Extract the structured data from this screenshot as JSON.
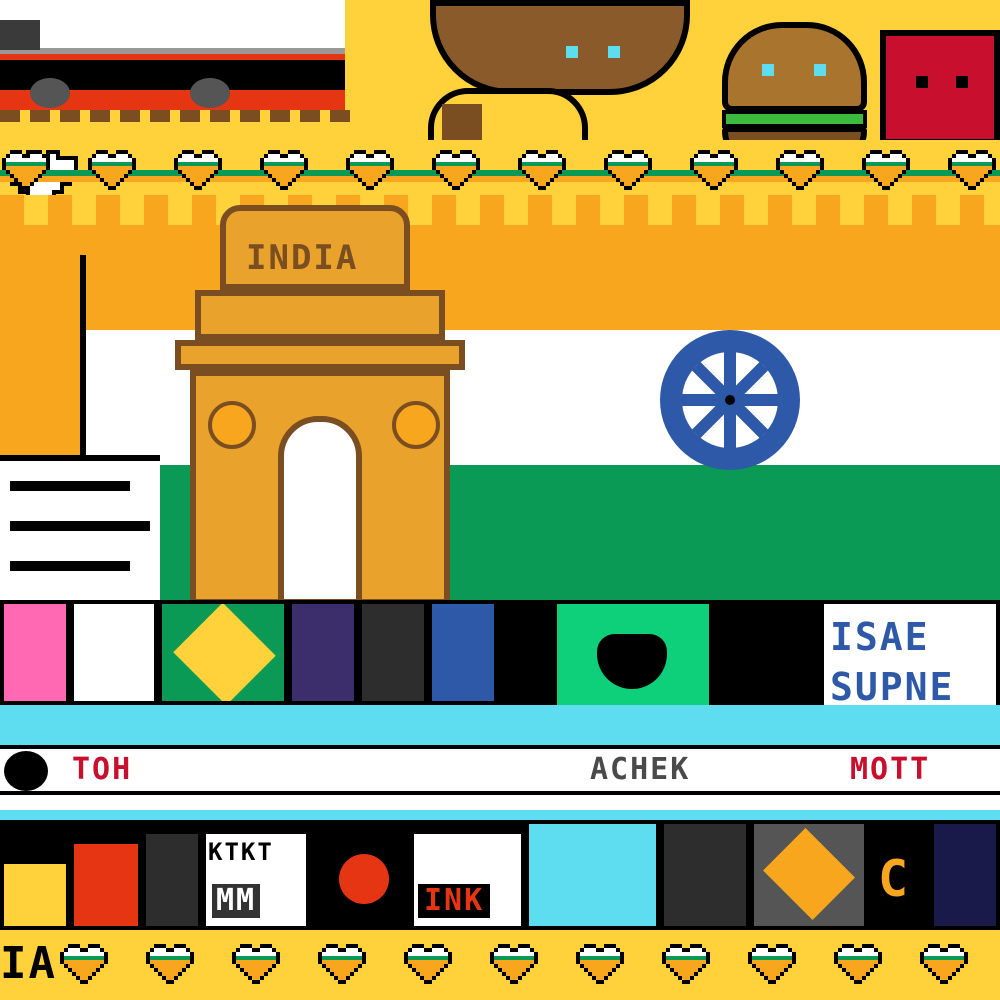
{
  "colors": {
    "saffron": "#F8A61E",
    "white": "#FFFFFF",
    "green": "#0A9A55",
    "chakra": "#2E59A8",
    "gate": "#E9A22B",
    "gate_dark": "#7A4E20",
    "cyan": "#5EDCF0",
    "black": "#000000",
    "red": "#E53512",
    "yellow": "#FFD23C"
  },
  "gate": {
    "inscription": "INDIA"
  },
  "tiles_top": [
    {
      "text": "ISAE"
    },
    {
      "text": "SUPNE"
    }
  ],
  "tiles_bottom": [
    {
      "text": "KTKT"
    },
    {
      "text": "MM"
    },
    {
      "text": "INK"
    },
    {
      "text": "C"
    }
  ],
  "banner_text": {
    "left": "TOH",
    "mid": "ACHEK",
    "right": "MOTT"
  },
  "bottom_left_text": "IA",
  "icons": {
    "food": [
      "dumpling-icon",
      "burger-icon",
      "drink-icon",
      "taco-icon"
    ],
    "chakra": "ashoka-chakra-icon",
    "tiger": "tiger-icon"
  }
}
